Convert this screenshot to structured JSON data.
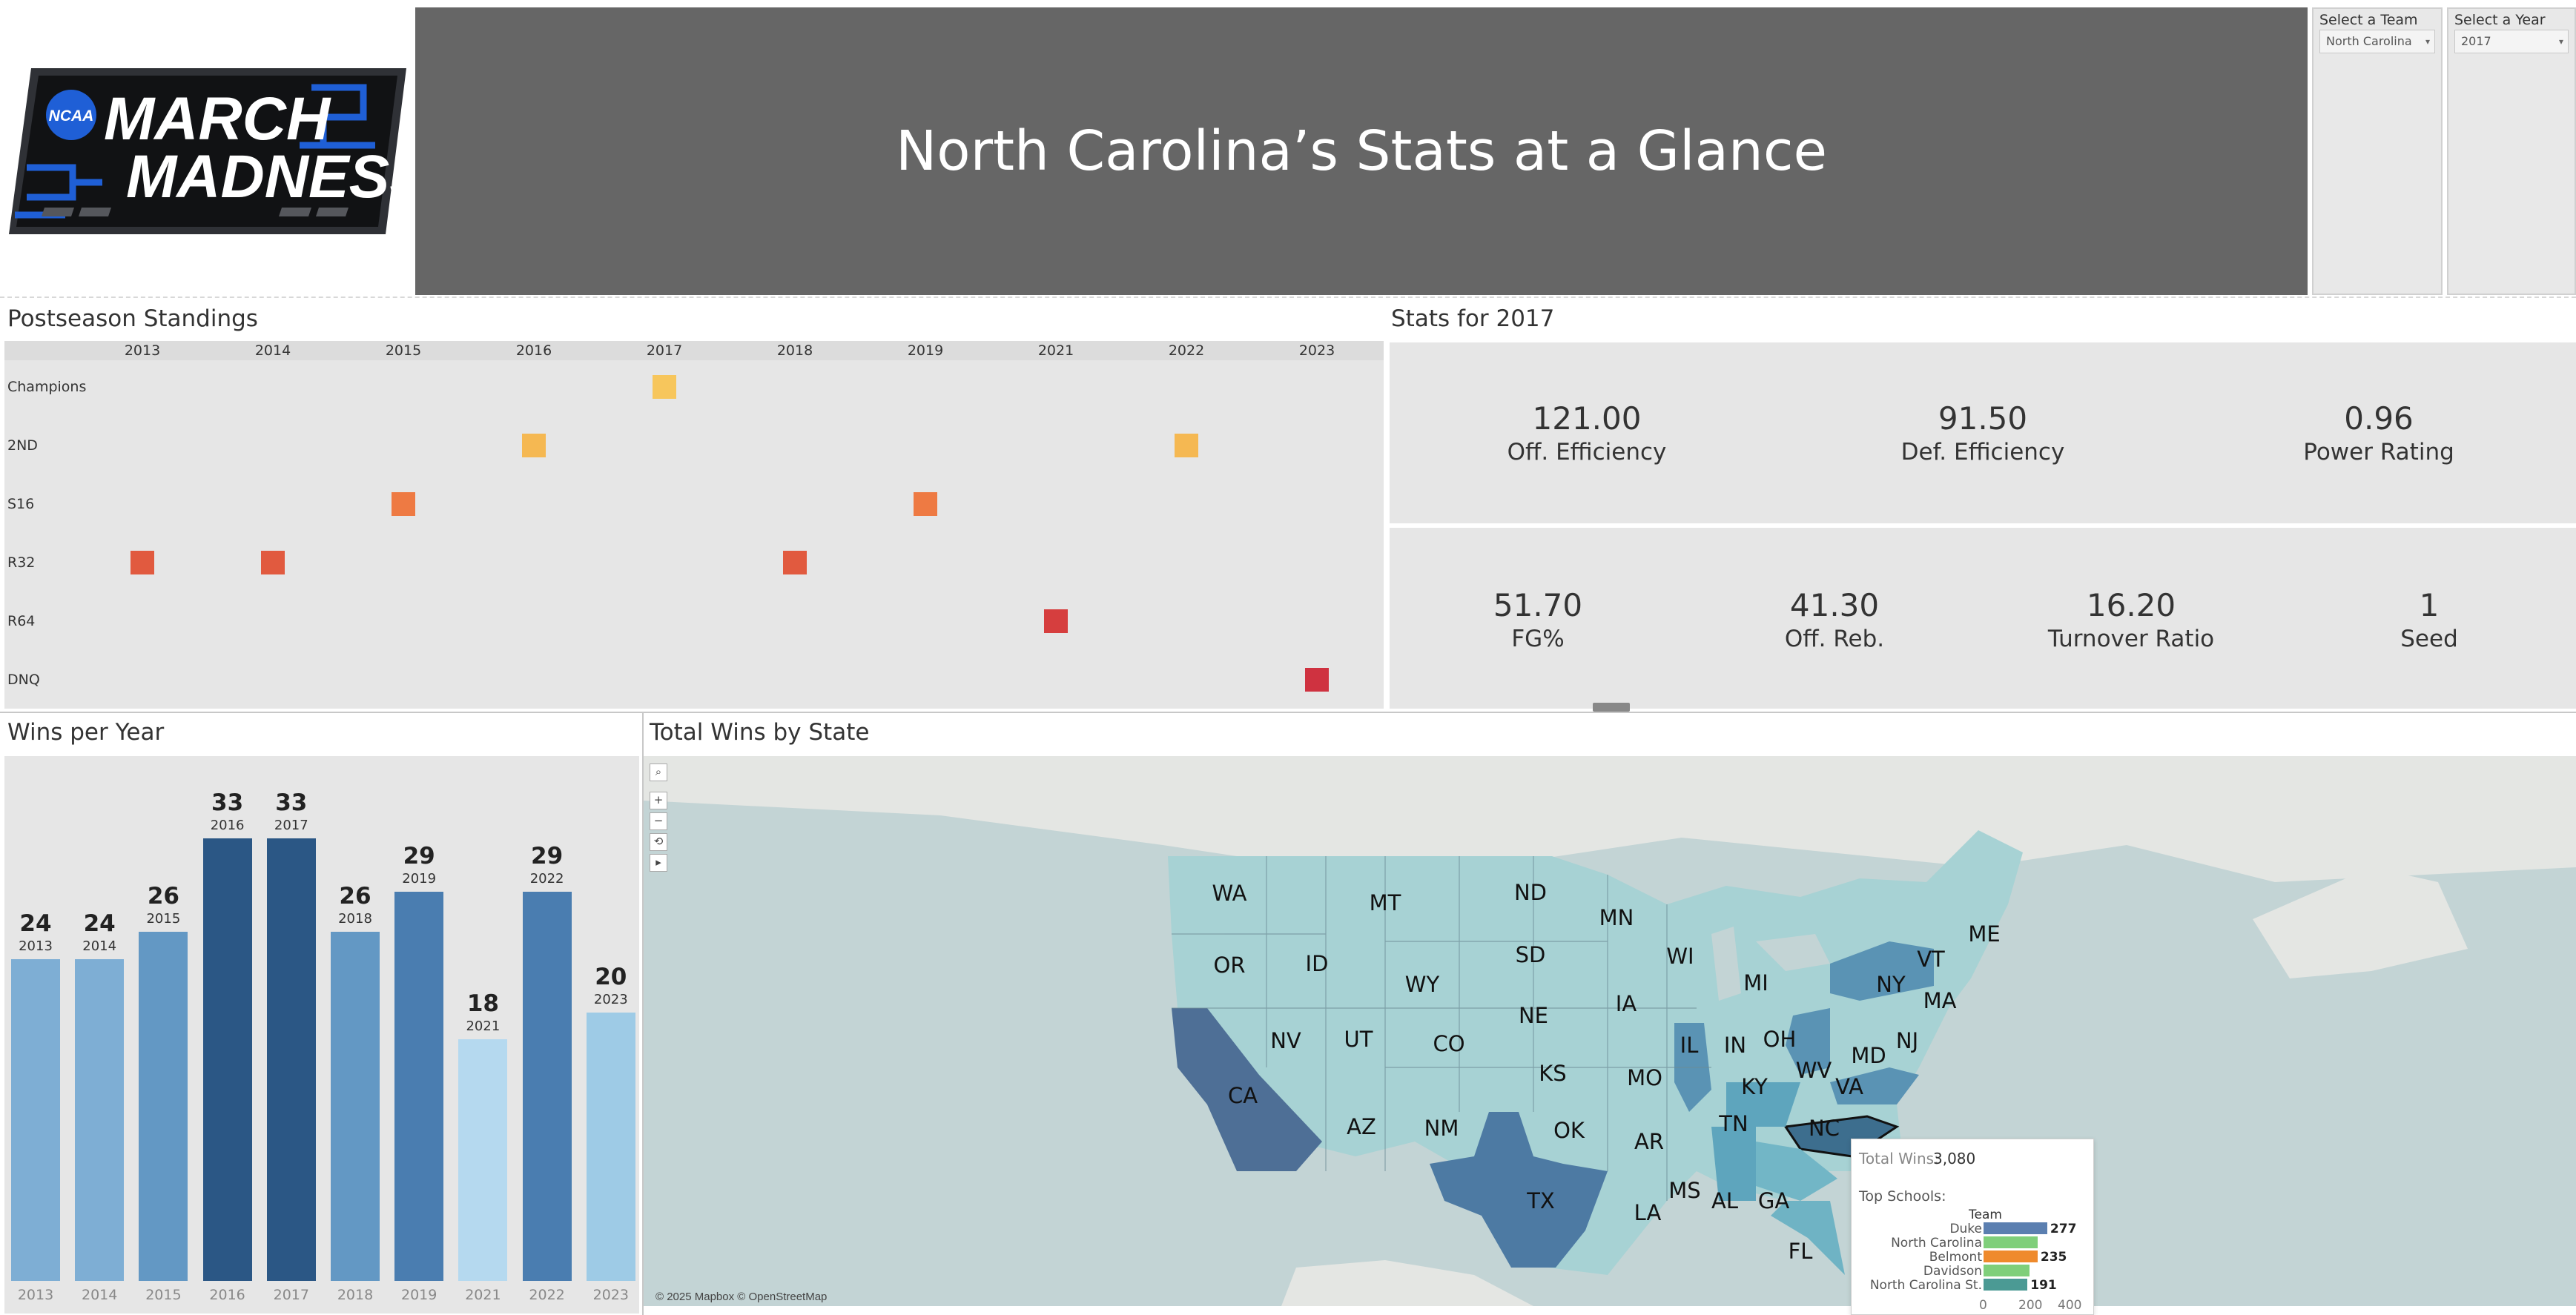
{
  "header": {
    "logo_text_top": "MARCH",
    "logo_text_bottom": "MADNESS",
    "logo_badge": "NCAA",
    "title": "North Carolina’s Stats at a Glance"
  },
  "filters": {
    "team": {
      "label": "Select a Team",
      "value": "North Carolina"
    },
    "year": {
      "label": "Select a Year",
      "value": "2017"
    }
  },
  "postseason": {
    "title": "Postseason Standings",
    "years": [
      "2013",
      "2014",
      "2015",
      "2016",
      "2017",
      "2018",
      "2019",
      "2021",
      "2022",
      "2023"
    ],
    "rounds": [
      "Champions",
      "2ND",
      "S16",
      "R32",
      "R64",
      "DNQ"
    ],
    "results": [
      {
        "year": "2013",
        "round": "R32",
        "color": "#e15a3f"
      },
      {
        "year": "2014",
        "round": "R32",
        "color": "#e15a3f"
      },
      {
        "year": "2015",
        "round": "S16",
        "color": "#ee7a43"
      },
      {
        "year": "2016",
        "round": "2ND",
        "color": "#f5b852"
      },
      {
        "year": "2017",
        "round": "Champions",
        "color": "#f7c65c"
      },
      {
        "year": "2018",
        "round": "R32",
        "color": "#e15a3f"
      },
      {
        "year": "2019",
        "round": "S16",
        "color": "#ee7a43"
      },
      {
        "year": "2021",
        "round": "R64",
        "color": "#d63e3e"
      },
      {
        "year": "2022",
        "round": "2ND",
        "color": "#f5b852"
      },
      {
        "year": "2023",
        "round": "DNQ",
        "color": "#cf3240"
      }
    ]
  },
  "stats": {
    "title": "Stats for 2017",
    "row1": [
      {
        "value": "121.00",
        "label": "Off. Efficiency"
      },
      {
        "value": "91.50",
        "label": "Def. Efficiency"
      },
      {
        "value": "0.96",
        "label": "Power Rating"
      }
    ],
    "row2": [
      {
        "value": "51.70",
        "label": "FG%"
      },
      {
        "value": "41.30",
        "label": "Off. Reb."
      },
      {
        "value": "16.20",
        "label": "Turnover Ratio"
      },
      {
        "value": "1",
        "label": "Seed"
      }
    ]
  },
  "wins": {
    "title": "Wins per Year",
    "chart_data": {
      "type": "bar",
      "categories": [
        "2013",
        "2014",
        "2015",
        "2016",
        "2017",
        "2018",
        "2019",
        "2021",
        "2022",
        "2023"
      ],
      "values": [
        24,
        24,
        26,
        33,
        33,
        26,
        29,
        18,
        29,
        20
      ],
      "colors": [
        "#7eaed4",
        "#7eaed4",
        "#6398c4",
        "#2b5785",
        "#2b5785",
        "#6398c4",
        "#4a7db0",
        "#b5d9ef",
        "#4a7db0",
        "#9ecbe6"
      ],
      "ylim": [
        0,
        35
      ]
    }
  },
  "map": {
    "title": "Total Wins by State",
    "attribution": "© 2025 Mapbox © OpenStreetMap",
    "states": [
      "WA",
      "OR",
      "CA",
      "NV",
      "ID",
      "MT",
      "WY",
      "UT",
      "AZ",
      "CO",
      "NM",
      "ND",
      "SD",
      "NE",
      "KS",
      "OK",
      "TX",
      "MN",
      "IA",
      "MO",
      "AR",
      "LA",
      "WI",
      "IL",
      "MI",
      "IN",
      "OH",
      "KY",
      "TN",
      "MS",
      "AL",
      "GA",
      "FL",
      "NC",
      "VA",
      "WV",
      "MD",
      "NJ",
      "NY",
      "VT",
      "MA",
      "ME"
    ],
    "tooltip": {
      "total_label": "Total Wins:",
      "total_value": "3,080",
      "top_label": "Top Schools:",
      "column_header": "Team",
      "schools": [
        {
          "name": "Duke",
          "wins": 277,
          "color": "#5b7fb0",
          "label": "277"
        },
        {
          "name": "North Carolina",
          "wins": 235,
          "color": "#7fcf7a",
          "label": ""
        },
        {
          "name": "Belmont",
          "wins": 235,
          "color": "#ef8a2c",
          "label": "235"
        },
        {
          "name": "Davidson",
          "wins": 200,
          "color": "#7fcf7a",
          "label": ""
        },
        {
          "name": "North Carolina St.",
          "wins": 191,
          "color": "#4b9a94",
          "label": "191"
        }
      ],
      "axis_ticks": [
        "0",
        "200",
        "400"
      ]
    }
  }
}
